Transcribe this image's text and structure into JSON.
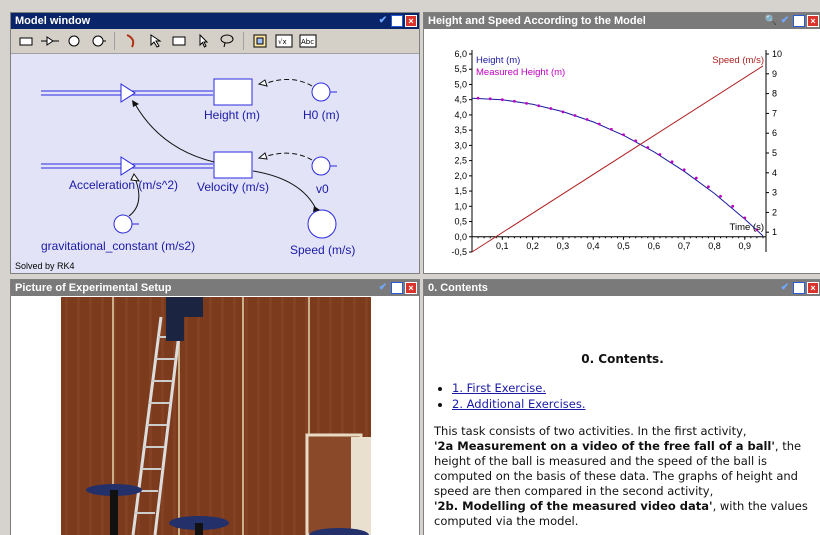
{
  "model_window": {
    "title": "Model window",
    "toolbar_tools": [
      "stock-tool-icon",
      "flow-tool-icon",
      "auxiliary-tool-icon",
      "constant-tool-icon",
      "connector-tool-icon",
      "delete-tool-icon",
      "text-tool-icon",
      "pointer-tool-icon",
      "lasso-tool-icon",
      "fit-tool-icon",
      "formula-tool-icon",
      "abc-tool-icon"
    ],
    "labels": {
      "height": "Height (m)",
      "h0": "H0 (m)",
      "acceleration": "Acceleration (m/s^2)",
      "velocity": "Velocity (m/s)",
      "v0": "v0",
      "gravitational_constant": "gravitational_constant (m/s2)",
      "speed": "Speed (m/s)"
    },
    "solved_by": "Solved by RK4"
  },
  "graph_window": {
    "title": "Height and Speed  According to the Model"
  },
  "chart_data": {
    "type": "line",
    "xlabel": "Time (s)",
    "x_ticks": [
      "0,1",
      "0,2",
      "0,3",
      "0,4",
      "0,5",
      "0,6",
      "0,7",
      "0,8",
      "0,9"
    ],
    "y_left_ticks": [
      "-0,5",
      "0,0",
      "0,5",
      "1,0",
      "1,5",
      "2,0",
      "2,5",
      "3,0",
      "3,5",
      "4,0",
      "4,5",
      "5,0",
      "5,5",
      "6,0"
    ],
    "y_right_ticks": [
      "1",
      "2",
      "3",
      "4",
      "5",
      "6",
      "7",
      "8",
      "9",
      "10"
    ],
    "xlim": [
      0,
      0.97
    ],
    "ylim_left": [
      -0.5,
      6.0
    ],
    "ylim_right": [
      0,
      10
    ],
    "series": [
      {
        "name": "Height (m)",
        "color": "#1a1a9e",
        "axis": "left",
        "x": [
          0,
          0.1,
          0.2,
          0.3,
          0.4,
          0.5,
          0.6,
          0.7,
          0.8,
          0.9,
          0.96
        ],
        "y": [
          4.55,
          4.5,
          4.35,
          4.11,
          3.77,
          3.33,
          2.79,
          2.15,
          1.42,
          0.58,
          0.03
        ]
      },
      {
        "name": "Measured Height (m)",
        "color": "#c000c0",
        "axis": "left",
        "style": "points",
        "x": [
          0.02,
          0.06,
          0.1,
          0.14,
          0.18,
          0.22,
          0.26,
          0.3,
          0.34,
          0.38,
          0.42,
          0.46,
          0.5,
          0.54,
          0.58,
          0.62,
          0.66,
          0.7,
          0.74,
          0.78,
          0.82,
          0.86,
          0.9,
          0.94
        ],
        "y": [
          4.55,
          4.53,
          4.5,
          4.45,
          4.38,
          4.3,
          4.21,
          4.1,
          3.98,
          3.85,
          3.7,
          3.53,
          3.35,
          3.15,
          2.93,
          2.7,
          2.46,
          2.2,
          1.93,
          1.64,
          1.33,
          1.0,
          0.62,
          0.23
        ]
      },
      {
        "name": "Speed (m/s)",
        "color": "#b02020",
        "axis": "right",
        "x": [
          0,
          0.96
        ],
        "y": [
          0,
          9.4
        ]
      }
    ]
  },
  "picture_window": {
    "title": "Picture of Experimental Setup"
  },
  "contents_window": {
    "title": "0. Contents",
    "heading": "0. Contents.",
    "links": [
      "1. First Exercise.",
      "2. Additional Exercises."
    ],
    "para_1": "This task consists of two activities. In the first activity,",
    "bold_1": "'2a Measurement on a video of the free fall of a ball'",
    "para_2": ", the height of the ball is measured and the speed of the ball is computed on the basis of these data. The graphs of height and speed are then compared in the second activity,",
    "bold_2": "'2b. Modelling of the measured video data'",
    "para_3": ", with the values computed via the model."
  }
}
